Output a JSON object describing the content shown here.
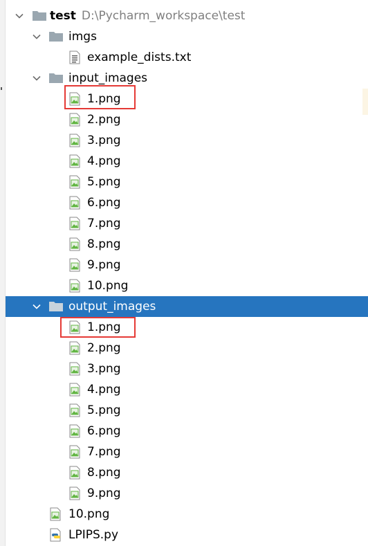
{
  "project": {
    "name": "test",
    "path": "D:\\Pycharm_workspace\\test"
  },
  "imgs_folder": {
    "name": "imgs",
    "file": "example_dists.txt"
  },
  "input_images": {
    "name": "input_images",
    "files": [
      "1.png",
      "2.png",
      "3.png",
      "4.png",
      "5.png",
      "6.png",
      "7.png",
      "8.png",
      "9.png",
      "10.png"
    ]
  },
  "output_images": {
    "name": "output_images",
    "files": [
      "1.png",
      "2.png",
      "3.png",
      "4.png",
      "5.png",
      "6.png",
      "7.png",
      "8.png",
      "9.png"
    ]
  },
  "root_files": [
    "10.png",
    "LPIPS.py"
  ],
  "colors": {
    "selection": "#2675bf",
    "highlight_box": "#e53935",
    "folder": "#9aa7b0",
    "image_icon_green": "#62b543",
    "python_blue": "#3776ab",
    "python_yellow": "#ffd43b"
  },
  "icons": {
    "chevron": "chevron-down-icon",
    "folder": "folder-icon",
    "text_file": "text-file-icon",
    "image_file": "image-file-icon",
    "python_file": "python-file-icon"
  }
}
